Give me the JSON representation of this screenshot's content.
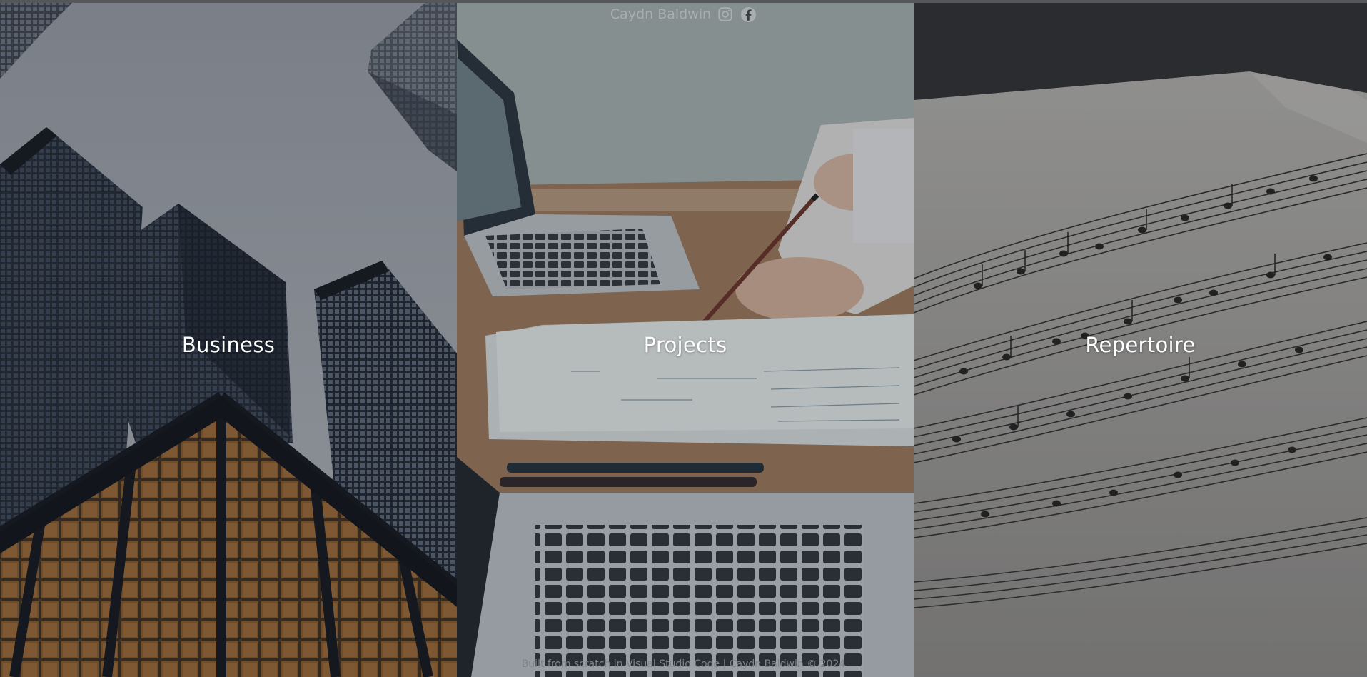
{
  "header": {
    "brand": "Caydn Baldwin",
    "icons": [
      "instagram-icon",
      "facebook-icon"
    ]
  },
  "panels": [
    {
      "label": "Business"
    },
    {
      "label": "Projects"
    },
    {
      "label": "Repertoire"
    }
  ],
  "footer": {
    "text": "Built from scratch in Visual Studio Code | Caydn Baldwin © 2024"
  },
  "colors": {
    "overlay": "#2a2c30",
    "label_text": "#ffffff",
    "header_text": "#a9aeb0",
    "footer_text": "#7c8488"
  }
}
